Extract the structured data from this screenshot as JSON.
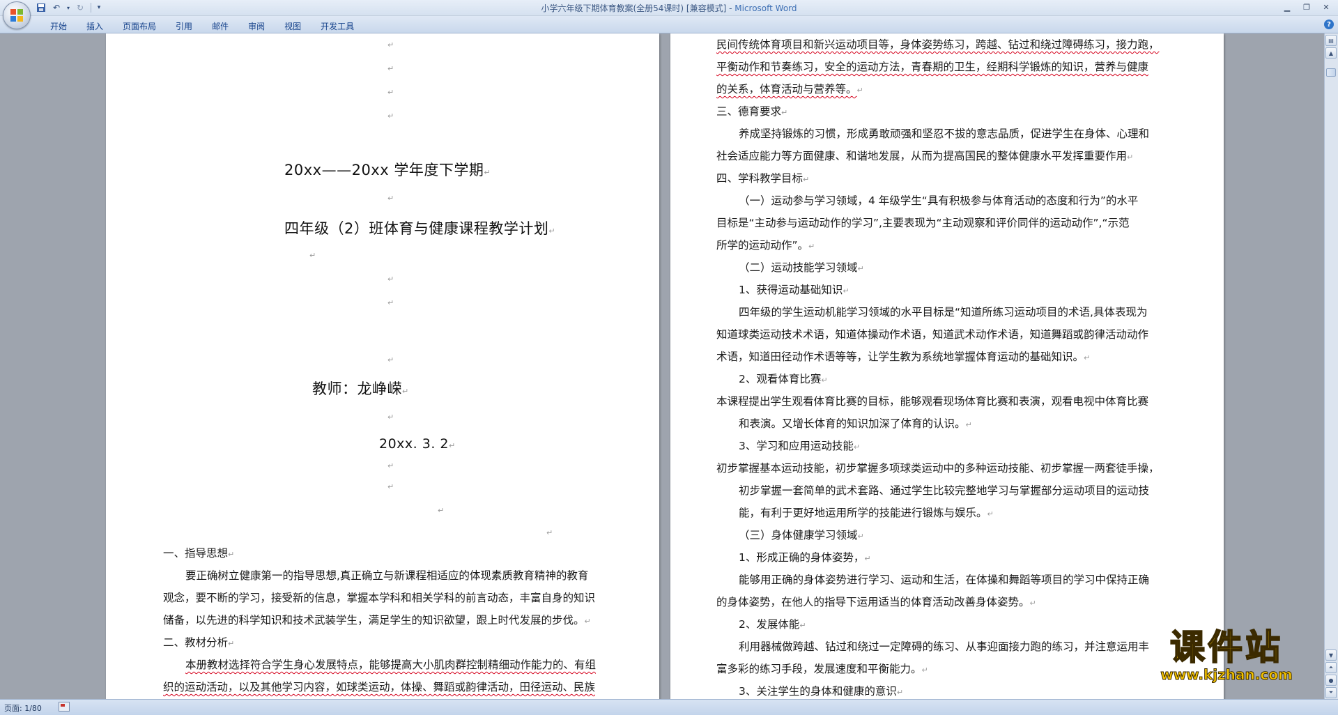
{
  "window": {
    "title": "小学六年级下期体育教案(全册54课时) [兼容模式] - ",
    "app_name": "Microsoft Word"
  },
  "ribbon": {
    "tabs": [
      "开始",
      "插入",
      "页面布局",
      "引用",
      "邮件",
      "审阅",
      "视图",
      "开发工具"
    ]
  },
  "cover": {
    "school_year": "20xx——20xx 学年度下学期",
    "plan_title": "四年级（2）班体育与健康课程教学计划",
    "teacher": "教师：龙峥嵘",
    "date": "20xx. 3. 2"
  },
  "left_body": [
    "一、指导思想",
    "要正确树立健康第一的指导思想,真正确立与新课程相适应的体现素质教育精神的教育",
    "观念，要不断的学习，接受新的信息，掌握本学科和相关学科的前言动态，丰富自身的知识",
    "储备，以先进的科学知识和技术武装学生，满足学生的知识欲望，跟上时代发展的步伐。",
    "二、教材分析",
    "本册教材选择符合学生身心发展特点，能够提高大小肌肉群控制精细动作能力的、有组",
    "织的运动活动，以及其他学习内容，如球类运动，体操、舞蹈或韵律活动，田径运动、民族"
  ],
  "right_body": [
    "民间传统体育项目和新兴运动项目等，身体姿势练习，跨越、钻过和绕过障碍练习，接力跑，",
    "平衡动作和节奏练习，安全的运动方法，青春期的卫生，经期科学锻炼的知识，营养与健康",
    "的关系，体育活动与营养等。",
    "三、德育要求",
    "养成坚持锻炼的习惯，形成勇敢顽强和坚忍不拔的意志品质，促进学生在身体、心理和",
    "社会适应能力等方面健康、和谐地发展，从而为提高国民的整体健康水平发挥重要作用",
    "四、学科教学目标",
    "（一）运动参与学习领域，4 年级学生“具有积极参与体育活动的态度和行为”的水平",
    "目标是“主动参与运动动作的学习”,主要表现为“主动观察和评价同伴的运动动作”,“示范",
    "所学的运动动作”。",
    "（二）运动技能学习领域",
    "1、获得运动基础知识",
    "四年级的学生运动机能学习领域的水平目标是“知道所练习运动项目的术语,具体表现为",
    "知道球类运动技术术语，知道体操动作术语，知道武术动作术语，知道舞蹈或韵律活动动作",
    "术语，知道田径动作术语等等，让学生教为系统地掌握体育运动的基础知识。",
    "2、观看体育比赛",
    "本课程提出学生观看体育比赛的目标，能够观看现场体育比赛和表演，观看电视中体育比赛",
    "和表演。又增长体育的知识加深了体育的认识。",
    "3、学习和应用运动技能",
    "初步掌握基本运动技能，初步掌握多项球类运动中的多种运动技能、初步掌握一两套徒手操，",
    "初步掌握一套简单的武术套路、通过学生比较完整地学习与掌握部分运动项目的运动技",
    "能，有利于更好地运用所学的技能进行锻炼与娱乐。",
    "（三）身体健康学习领域",
    "1、形成正确的身体姿势，",
    "能够用正确的身体姿势进行学习、运动和生活，在体操和舞蹈等项目的学习中保持正确",
    "的身体姿势，在他人的指导下运用适当的体育活动改善身体姿势。",
    "2、发展体能",
    "利用器械做跨越、钻过和绕过一定障碍的练习、从事迎面接力跑的练习，并注意运用丰",
    "富多彩的练习手段，发展速度和平衡能力。",
    "3、关注学生的身体和健康的意识"
  ],
  "status": {
    "page_indicator": "页面: 1/80"
  },
  "watermark": {
    "title": "课件站",
    "url": "www.kjzhan.com"
  }
}
